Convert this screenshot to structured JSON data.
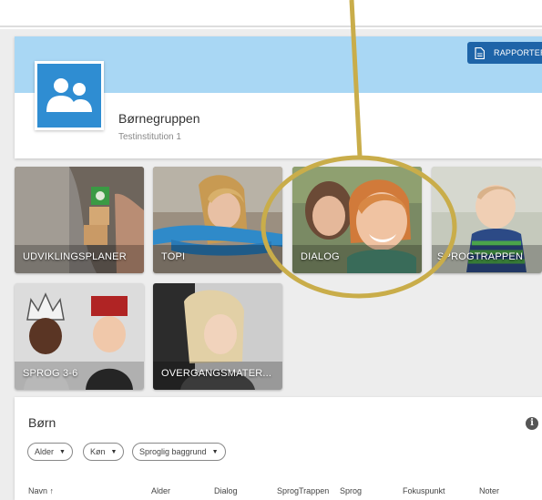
{
  "colors": {
    "banner": "#a9d7f4",
    "accent": "#1e64a8",
    "avatar": "#2f8dd2",
    "annotation": "#c9ad4a"
  },
  "header": {
    "report_label": "RAPPORTER",
    "report_icon": "document-icon",
    "group_icon": "people-icon",
    "group_name": "Børnegruppen",
    "institution": "Testinstitution 1"
  },
  "tiles": [
    {
      "label": "UDVIKLINGSPLANER"
    },
    {
      "label": "TOPI"
    },
    {
      "label": "DIALOG"
    },
    {
      "label": "SPROGTRAPPEN"
    },
    {
      "label": "SPROG 3-6"
    },
    {
      "label": "OVERGANGSMATER..."
    }
  ],
  "children": {
    "title": "Børn",
    "info_icon": "info-icon",
    "filters": [
      {
        "label": "Alder"
      },
      {
        "label": "Køn"
      },
      {
        "label": "Sproglig baggrund"
      }
    ],
    "columns": [
      "Navn ↑",
      "Alder",
      "Dialog",
      "SprogTrappen",
      "Sprog",
      "Fokuspunkt",
      "Noter"
    ]
  }
}
